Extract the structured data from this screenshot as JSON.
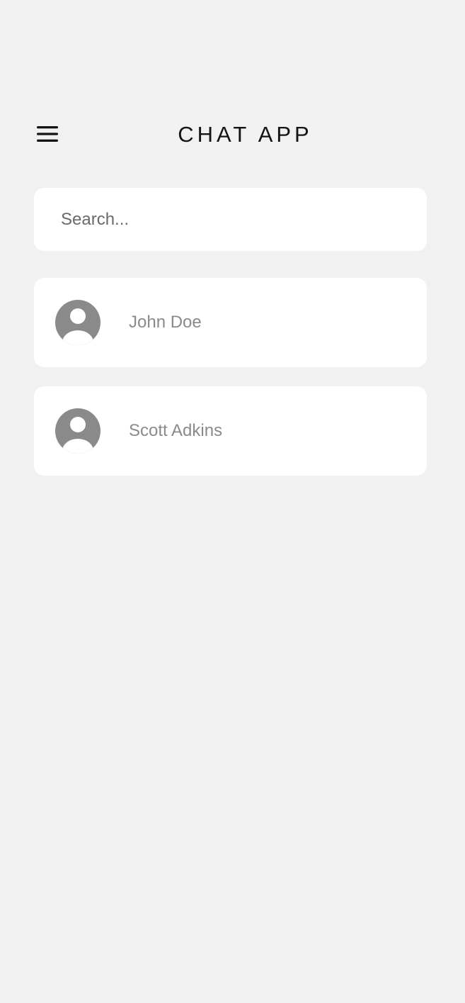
{
  "header": {
    "menu_icon": "hamburger-menu-icon",
    "title": "CHAT APP"
  },
  "search": {
    "placeholder": "Search...",
    "value": ""
  },
  "contacts": [
    {
      "name": "John Doe",
      "avatar_icon": "user-avatar-icon"
    },
    {
      "name": "Scott Adkins",
      "avatar_icon": "user-avatar-icon"
    }
  ],
  "colors": {
    "background": "#f1f1f1",
    "card": "#ffffff",
    "avatar": "#8a8a8a",
    "title_text": "#141414",
    "name_text": "#8a8a8a"
  }
}
